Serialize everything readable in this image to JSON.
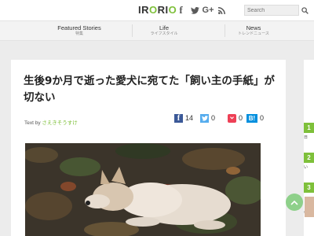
{
  "header": {
    "logo": [
      "IR",
      "O",
      "RI",
      "O"
    ],
    "social": [
      {
        "name": "facebook",
        "glyph": "f"
      },
      {
        "name": "twitter",
        "glyph": "🐦"
      },
      {
        "name": "google-plus",
        "glyph": "G+"
      },
      {
        "name": "rss",
        "glyph": "RSS"
      }
    ],
    "search_placeholder": "Search"
  },
  "nav": [
    {
      "label": "Featured Stories",
      "sublabel": "特集"
    },
    {
      "label": "Life",
      "sublabel": "ライフスタイル"
    },
    {
      "label": "News",
      "sublabel": "トレンドニュース"
    }
  ],
  "article": {
    "title": "生後9か月で逝った愛犬に宛てた「飼い主の手紙」が切ない",
    "byline_prefix": "Text by",
    "author": "さえきそうすけ",
    "share": {
      "facebook": "14",
      "twitter": "0",
      "pocket": "0",
      "hatena": "0",
      "hatena_label": "B!"
    }
  },
  "rail": {
    "rank_numbers": [
      "1",
      "2",
      "3"
    ],
    "snippets": [
      "日",
      "い",
      "い"
    ]
  },
  "colors": {
    "accent": "#7ec03a",
    "facebook": "#3b5998",
    "twitter": "#55acee",
    "pocket": "#ee4056",
    "hatena": "#008fde"
  }
}
